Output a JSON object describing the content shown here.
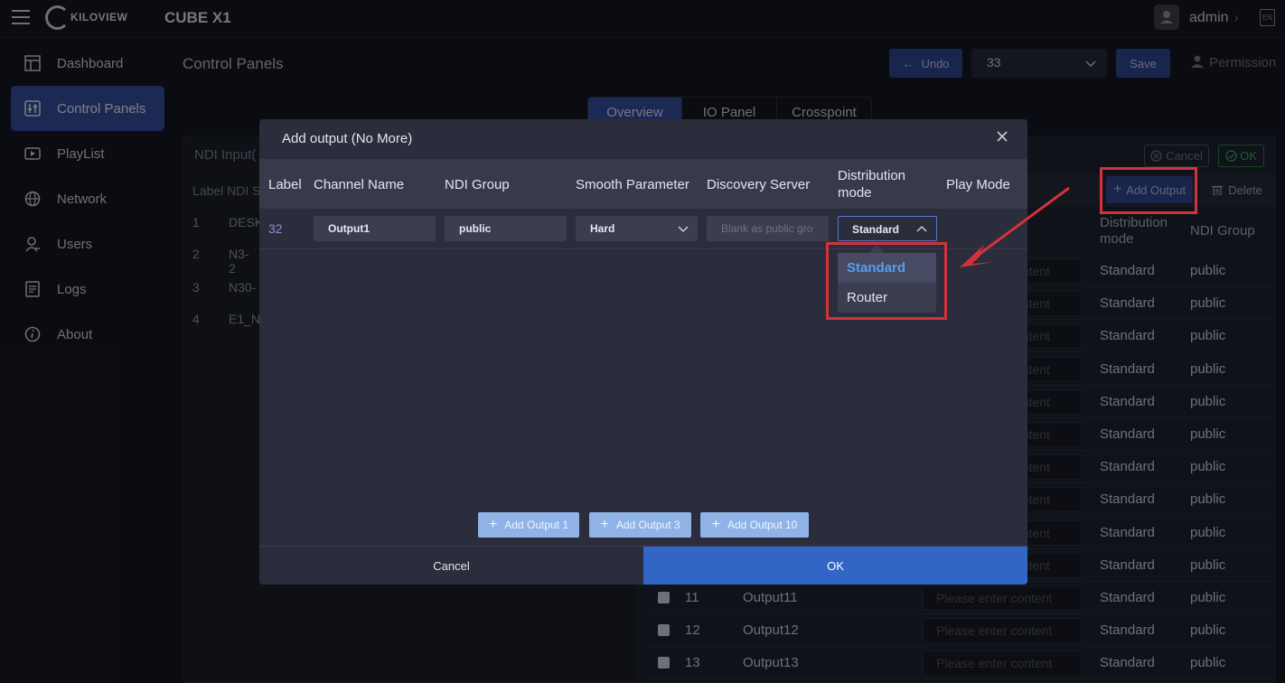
{
  "header": {
    "logo_text": "KILOVIEW",
    "product": "CUBE X1",
    "user": "admin",
    "lang": "EN"
  },
  "sidebar": {
    "items": [
      {
        "label": "Dashboard",
        "icon": "dashboard-icon"
      },
      {
        "label": "Control Panels",
        "icon": "sliders-icon",
        "active": true
      },
      {
        "label": "PlayList",
        "icon": "playlist-icon"
      },
      {
        "label": "Network",
        "icon": "globe-icon"
      },
      {
        "label": "Users",
        "icon": "user-icon"
      },
      {
        "label": "Logs",
        "icon": "logs-icon"
      },
      {
        "label": "About",
        "icon": "info-icon"
      }
    ]
  },
  "page": {
    "title": "Control Panels",
    "undo": "Undo",
    "selected_panel": "33",
    "save": "Save",
    "permission": "Permission"
  },
  "tabs": [
    "Overview",
    "IO Panel",
    "Crosspoint"
  ],
  "left_panel": {
    "title": "NDI Input(",
    "header": "Label NDI S",
    "rows": [
      {
        "num": "1",
        "name": "DESK"
      },
      {
        "num": "2",
        "name": "N3-2"
      },
      {
        "num": "3",
        "name": "N30-"
      },
      {
        "num": "4",
        "name": "E1_N"
      }
    ]
  },
  "right_panel": {
    "cancel": "Cancel",
    "ok": "OK",
    "add_output": "Add Output",
    "delete": "Delete",
    "headers": {
      "distribution_mode": "Distribution mode",
      "ndi_group": "NDI Group"
    },
    "placeholder": "Please enter content",
    "partial_placeholder": "ontent",
    "rows": [
      {
        "num": "",
        "name": "",
        "mode": "Standard",
        "group": "public"
      },
      {
        "num": "",
        "name": "",
        "mode": "Standard",
        "group": "public"
      },
      {
        "num": "",
        "name": "",
        "mode": "Standard",
        "group": "public"
      },
      {
        "num": "",
        "name": "",
        "mode": "Standard",
        "group": "public"
      },
      {
        "num": "",
        "name": "",
        "mode": "Standard",
        "group": "public"
      },
      {
        "num": "",
        "name": "",
        "mode": "Standard",
        "group": "public"
      },
      {
        "num": "",
        "name": "",
        "mode": "Standard",
        "group": "public"
      },
      {
        "num": "",
        "name": "",
        "mode": "Standard",
        "group": "public"
      },
      {
        "num": "",
        "name": "",
        "mode": "Standard",
        "group": "public"
      },
      {
        "num": "",
        "name": "",
        "mode": "Standard",
        "group": "public"
      },
      {
        "num": "11",
        "name": "Output11",
        "mode": "Standard",
        "group": "public"
      },
      {
        "num": "12",
        "name": "Output12",
        "mode": "Standard",
        "group": "public"
      },
      {
        "num": "13",
        "name": "Output13",
        "mode": "Standard",
        "group": "public"
      }
    ]
  },
  "dialog": {
    "title": "Add output (No More)",
    "columns": {
      "label": "Label",
      "channel_name": "Channel Name",
      "ndi_group": "NDI Group",
      "smooth": "Smooth Parameter",
      "discovery": "Discovery Server",
      "distribution": "Distribution mode",
      "play_mode": "Play Mode"
    },
    "row": {
      "label": "32",
      "channel_name": "Output1",
      "ndi_group": "public",
      "smooth": "Hard",
      "discovery_placeholder": "Blank as public gro",
      "distribution": "Standard"
    },
    "dropdown_options": [
      "Standard",
      "Router"
    ],
    "dropdown_selected": "Standard",
    "add_buttons": [
      "Add Output 1",
      "Add Output 3",
      "Add Output 10"
    ],
    "cancel": "Cancel",
    "ok": "OK"
  },
  "colors": {
    "accent": "#344c99",
    "ok": "#3266c4",
    "highlight": "#d2333a",
    "selected_option": "#5a9df0"
  }
}
